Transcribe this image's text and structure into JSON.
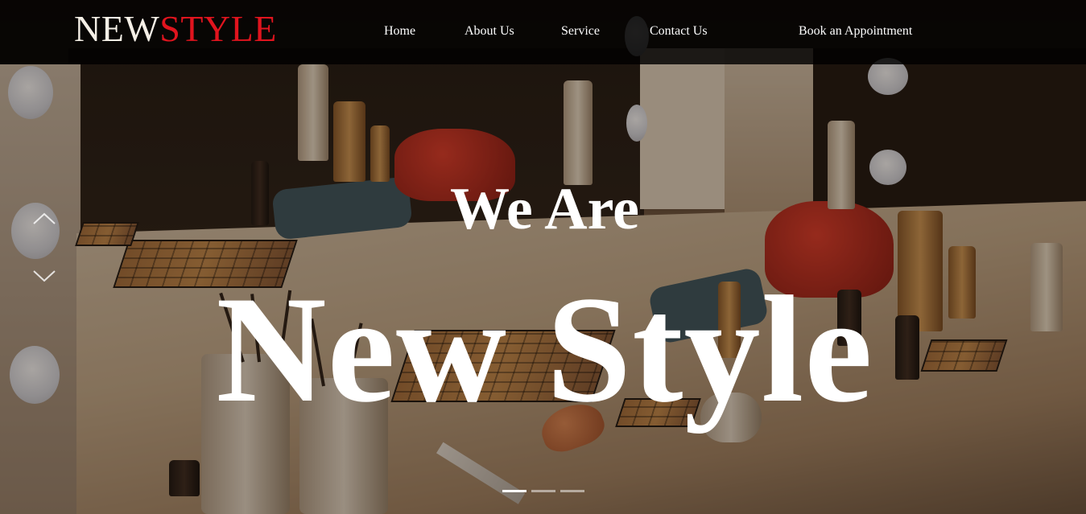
{
  "brand": {
    "logo_part1": "NEW",
    "logo_part2": "STYLE",
    "accent_color": "#e0141e"
  },
  "nav": {
    "items": [
      {
        "label": "Home"
      },
      {
        "label": "About Us"
      },
      {
        "label": "Service"
      },
      {
        "label": "Contact Us"
      }
    ],
    "cta_label": "Book an Appointment"
  },
  "hero": {
    "line1": "We Are",
    "line2": "New Style",
    "background_image": "makeup vanity table with palettes, brushes and bottles"
  },
  "slider": {
    "prev_icon": "chevron-up-icon",
    "next_icon": "chevron-down-icon",
    "slide_count": 3,
    "active_slide": 1
  }
}
